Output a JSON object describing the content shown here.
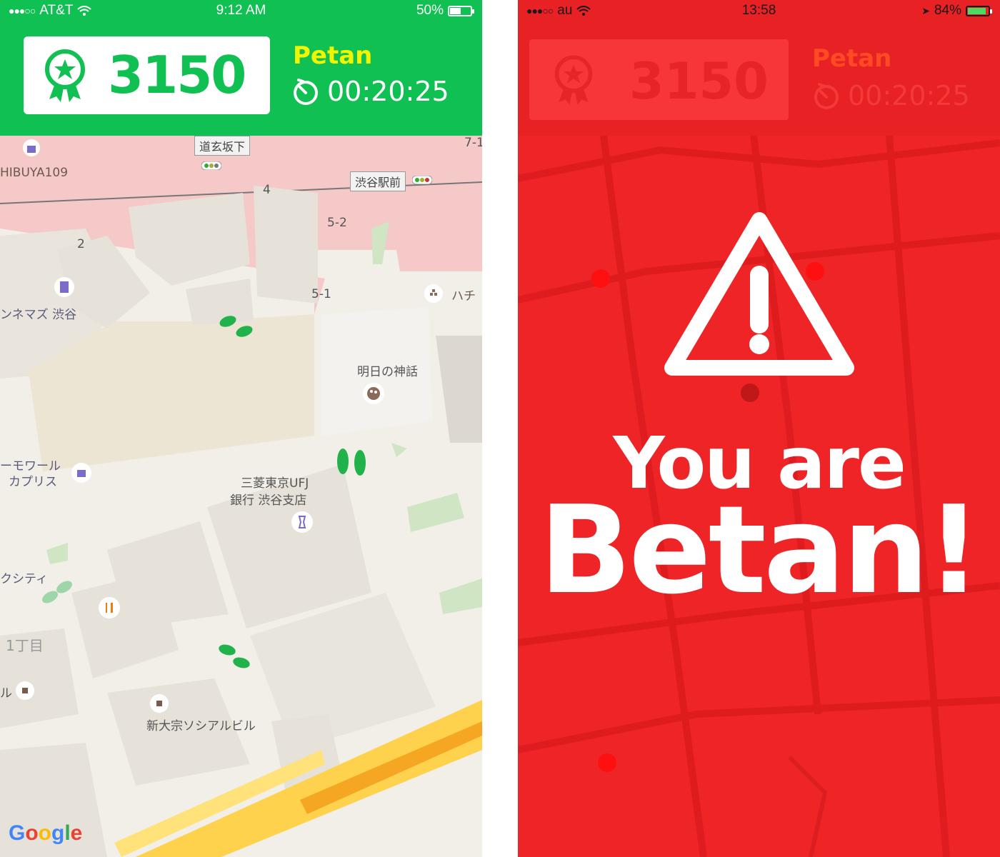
{
  "left_screen": {
    "status_bar": {
      "carrier": "AT&T",
      "signal_dots": "●●●○○",
      "time": "9:12 AM",
      "battery_percent": "50%",
      "battery_level": 0.5
    },
    "header": {
      "score": "3150",
      "player_name": "Petan",
      "timer": "00:20:25"
    },
    "map": {
      "labels": {
        "dogenzaka_sign": "道玄坂下",
        "shibuya_station_sign": "渋谷駅前",
        "shibuya109": "HIBUYA109",
        "cinema": "ンネマズ 渋谷",
        "myth": "明日の神話",
        "hachi": "ハチ",
        "bank_line1": "三菱東京UFJ",
        "bank_line2": "銀行 渋谷支店",
        "capris_line1": "ーモワール",
        "capris_line2": "カプリス",
        "city": "クシティ",
        "chome": "1丁目",
        "ru": "ル",
        "building": "新大宗ソシアルビル",
        "num_4": "4",
        "num_2": "2",
        "num_52": "5-2",
        "num_51": "5-1",
        "num_71": "7-1"
      },
      "google_logo": [
        "G",
        "o",
        "o",
        "g",
        "l",
        "e"
      ],
      "colors": {
        "footprints": "#22b24c",
        "rail": "#f6c9c9",
        "highway": "#ffd24d"
      }
    }
  },
  "right_screen": {
    "status_bar": {
      "carrier": "au",
      "signal_dots": "●●●○○",
      "time": "13:58",
      "battery_percent": "84%",
      "battery_level": 0.84
    },
    "ghost_header": {
      "score": "3150",
      "player_name": "Petan",
      "timer": "00:20:25"
    },
    "message_line1": "You are",
    "message_line2": "Betan!",
    "colors": {
      "background": "#ee2426",
      "accent": "#ffffff"
    }
  },
  "icons": [
    "medal-icon",
    "stopwatch-icon",
    "wifi-icon",
    "warning-icon",
    "shopping-icon",
    "restaurant-icon",
    "art-icon"
  ]
}
